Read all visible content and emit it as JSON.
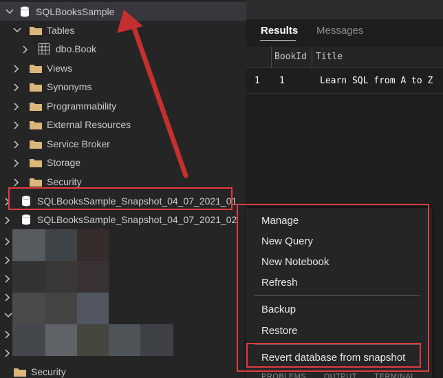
{
  "tree": {
    "root": "SQLBooksSample",
    "tables_folder": "Tables",
    "table_item": "dbo.Book",
    "folders": [
      "Views",
      "Synonyms",
      "Programmability",
      "External Resources",
      "Service Broker",
      "Storage",
      "Security"
    ],
    "snapshot1": "SQLBooksSample_Snapshot_04_07_2021_01",
    "snapshot2": "SQLBooksSample_Snapshot_04_07_2021_02",
    "bottom_security": "Security"
  },
  "results": {
    "tab_results": "Results",
    "tab_messages": "Messages",
    "columns": [
      "BookId",
      "Title"
    ],
    "row": {
      "index": "1",
      "bookid": "1",
      "title": "Learn SQL from A to Z"
    }
  },
  "context_menu": {
    "items_group1": [
      "Manage",
      "New Query",
      "New Notebook",
      "Refresh"
    ],
    "items_group2": [
      "Backup",
      "Restore"
    ],
    "revert": "Revert database from snapshot"
  },
  "bottom_panel_tabs": [
    "PROBLEMS",
    "OUTPUT",
    "TERMINAL"
  ],
  "colors": {
    "highlight": "#e23b3b",
    "folder": "#dcb67a"
  }
}
